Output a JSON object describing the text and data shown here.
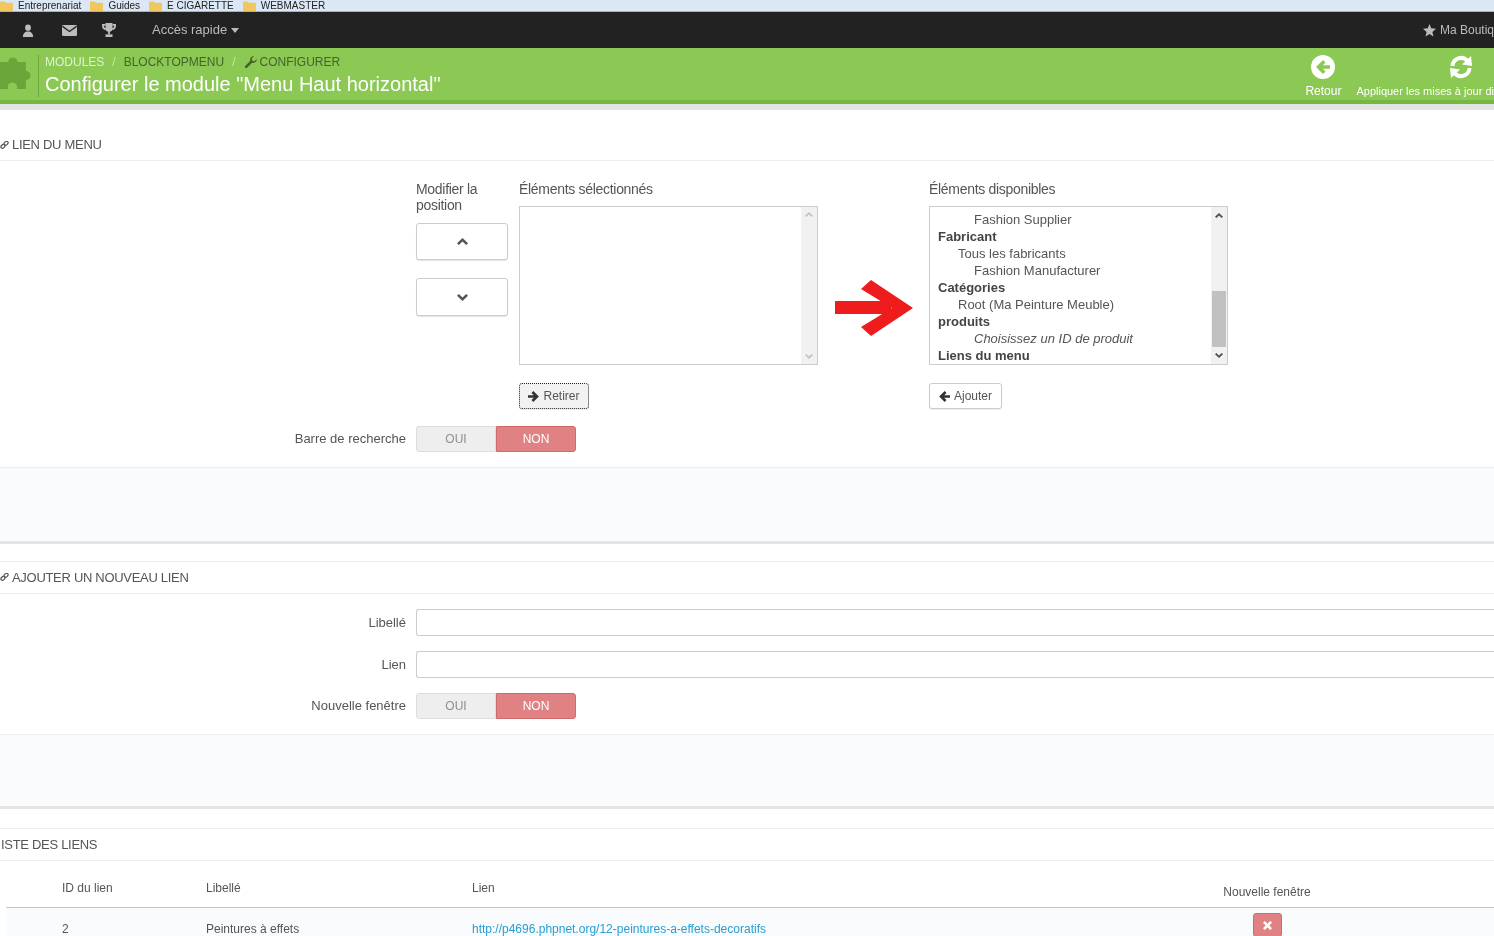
{
  "bookmarks_bar": {
    "items": [
      {
        "label": "Entreprenariat"
      },
      {
        "label": "Guides"
      },
      {
        "label": "E CIGARETTE"
      },
      {
        "label": "WEBMASTER"
      }
    ]
  },
  "top_bar": {
    "quick_access": "Accès rapide",
    "shop_name": "Ma Boutiq"
  },
  "header": {
    "breadcrumb": [
      {
        "kind": "link",
        "label": "MODULES"
      },
      {
        "kind": "separator",
        "label": "/"
      },
      {
        "kind": "text",
        "label": "BLOCKTOPMENU"
      },
      {
        "kind": "separator",
        "label": "/"
      },
      {
        "kind": "configure",
        "label": "CONFIGURER"
      }
    ],
    "title": "Configurer le module \"Menu Haut horizontal\"",
    "actions": [
      {
        "kind": "back",
        "label": "Retour"
      },
      {
        "kind": "refresh",
        "label": "Appliquer les mises à jour di"
      }
    ]
  },
  "menu_links": {
    "heading": "LIEN DU MENU",
    "position_label": "Modifier la position",
    "selected_label": "Éléments sélectionnés",
    "remove_button": {
      "label": "Retirer",
      "focused": true
    },
    "available_label": "Éléments disponibles",
    "available_options": [
      {
        "kind": "group",
        "children": [
          {
            "kind": "option",
            "children": [
              {
                "kind": "option",
                "label": "Fashion Supplier"
              }
            ]
          }
        ]
      },
      {
        "kind": "group",
        "label": "Fabricant",
        "children": [
          {
            "kind": "option",
            "label": "Tous les fabricants",
            "children": [
              {
                "kind": "option",
                "label": "Fashion Manufacturer"
              }
            ]
          }
        ]
      },
      {
        "kind": "group",
        "label": "Catégories",
        "children": [
          {
            "kind": "option",
            "label": "Root (Ma Peinture Meuble)"
          }
        ]
      },
      {
        "kind": "group",
        "label": "produits",
        "children": [
          {
            "kind": "hint",
            "label": "Choisissez un ID de produit"
          }
        ]
      },
      {
        "kind": "group",
        "label": "Liens du menu"
      }
    ],
    "add_button": {
      "label": "Ajouter",
      "focused": false
    },
    "search_bar": {
      "label": "Barre de recherche",
      "options": [
        {
          "label": "OUI",
          "selected": false
        },
        {
          "label": "NON",
          "selected": true
        }
      ]
    }
  },
  "new_link": {
    "heading": "AJOUTER UN NOUVEAU LIEN",
    "fields": [
      {
        "label": "Libellé"
      },
      {
        "label": "Lien"
      }
    ],
    "new_window": {
      "label": "Nouvelle fenêtre",
      "options": [
        {
          "label": "OUI",
          "selected": false
        },
        {
          "label": "NON",
          "selected": true
        }
      ]
    }
  },
  "links_list": {
    "heading": "ISTE DES LIENS",
    "columns": [
      {
        "label": "ID du lien"
      },
      {
        "label": "Libellé"
      },
      {
        "label": "Lien"
      },
      {
        "label": "Nouvelle fenêtre"
      }
    ],
    "rows": [
      {
        "id": "2",
        "label": "Peintures à effets",
        "url": "http://p4696.phpnet.org/12-peintures-a-effets-decoratifs",
        "new_window": false
      }
    ]
  }
}
